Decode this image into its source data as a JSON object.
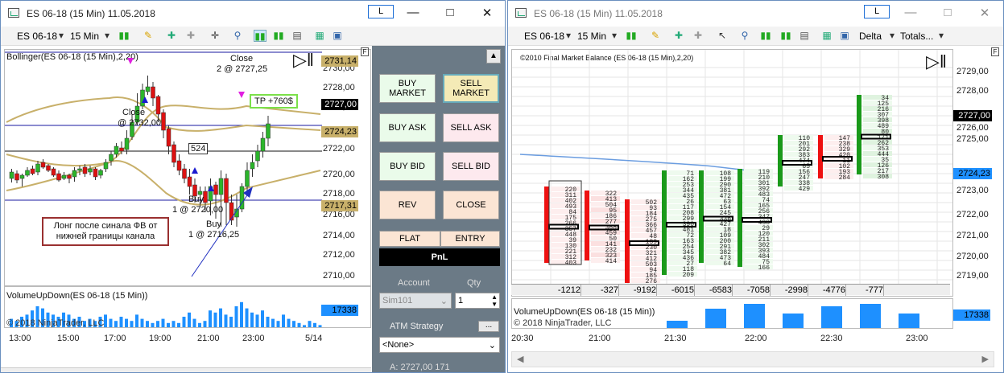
{
  "left": {
    "title": "ES 06-18 (15 Min)  11.05.2018",
    "tb_button": "L",
    "toolbar": {
      "instrument": "ES 06-18",
      "interval": "15 Min"
    },
    "indicator_label": "Bollinger(ES 06-18 (15 Min),2,20)",
    "prices": [
      "2730,00",
      "2728,00",
      "2726,00",
      "2722,00",
      "2720,00",
      "2718,00",
      "2716,00",
      "2714,00",
      "2712,00",
      "2710,00"
    ],
    "price_boxes": {
      "upper": "2731,14",
      "current": "2727,00",
      "mid": "2724,23",
      "lower": "2717,31"
    },
    "annotations": {
      "close_top": "Close",
      "close_top2": "2 @ 2727,25",
      "tp": "TP +760$",
      "close_mid": "Close",
      "close_mid2": "@ 2732,00",
      "trail": "524",
      "buy1": "Buy",
      "buy1b": "1 @ 2720,00",
      "buy2": "Buy",
      "buy2b": "1 @ 2716,25",
      "comment": "Лонг после синала ФВ от нижней границы канала"
    },
    "volume_label": "VolumeUpDown(ES 06-18 (15 Min))",
    "volume_box": "17338",
    "copyright": "© 2018 NinjaTrader, LLC",
    "x_labels": [
      "13:00",
      "15:00",
      "17:00",
      "19:00",
      "21:00",
      "23:00",
      "5/14"
    ],
    "vol_values": [
      4,
      3,
      5,
      6,
      8,
      10,
      9,
      7,
      6,
      5,
      7,
      6,
      4,
      5,
      3,
      4,
      3,
      5,
      6,
      4,
      3,
      5,
      4,
      3,
      6,
      4,
      3,
      2,
      3,
      4,
      2,
      3,
      2,
      5,
      7,
      4,
      2,
      3,
      8,
      7,
      9,
      6,
      5,
      10,
      12,
      9,
      7,
      6,
      8,
      5,
      4,
      3,
      6,
      4,
      3,
      2,
      1,
      3,
      2,
      1
    ]
  },
  "panel": {
    "buttons": {
      "buy_market": "BUY MARKET",
      "sell_market": "SELL MARKET",
      "buy_ask": "BUY ASK",
      "sell_ask": "SELL ASK",
      "buy_bid": "BUY BID",
      "sell_bid": "SELL BID",
      "rev": "REV",
      "close": "CLOSE",
      "flat": "FLAT",
      "entry": "ENTRY",
      "pnl": "PnL"
    },
    "account_label": "Account",
    "qty_label": "Qty",
    "account_value": "Sim101",
    "qty_value": "1",
    "atm_label": "ATM Strategy",
    "atm_btn": "...",
    "atm_value": "<None>",
    "bottom_text": "A: 2727,00   171"
  },
  "right": {
    "title": "ES 06-18 (15 Min)  11.05.2018",
    "tb_button": "L",
    "toolbar": {
      "instrument": "ES 06-18",
      "interval": "15 Min",
      "delta": "Delta",
      "totals": "Totals..."
    },
    "indicator_label": "©2010 Final Market Balance  (ES 06-18 (15 Min),2,20)",
    "prices": [
      "2729,00",
      "2728,00",
      "2726,00",
      "2725,00",
      "2723,00",
      "2722,00",
      "2721,00",
      "2720,00",
      "2719,00"
    ],
    "price_boxes": {
      "current": "2727,00",
      "mid": "2724,23"
    },
    "deltas": [
      "-1212",
      "-327",
      "-9192",
      "-6015",
      "-6583",
      "-7058",
      "-2998",
      "-4776",
      "-777"
    ],
    "volume_label": "VolumeUpDown(ES 06-18 (15 Min))",
    "volume_box": "17338",
    "copyright": "© 2018 NinjaTrader, LLC",
    "x_labels": [
      "20:30",
      "21:00",
      "21:30",
      "22:00",
      "22:30",
      "23:00"
    ],
    "vol_values": [
      0,
      3,
      8,
      10,
      6,
      9,
      10,
      6,
      0
    ]
  }
}
